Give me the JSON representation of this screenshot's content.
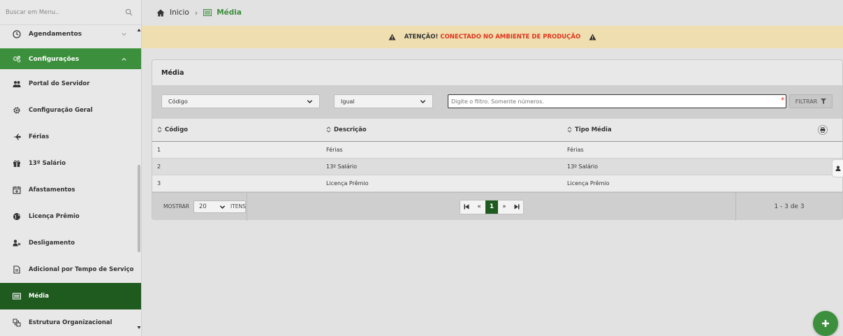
{
  "sidebar": {
    "search_placeholder": "Buscar em Menu..",
    "items": [
      {
        "label": "Agendamentos",
        "icon": "clock-icon"
      },
      {
        "label": "Configurações",
        "icon": "gears-icon"
      },
      {
        "label": "Portal do Servidor",
        "icon": "users-icon"
      },
      {
        "label": "Configuração Geral",
        "icon": "gear-icon"
      },
      {
        "label": "Férias",
        "icon": "plane-icon"
      },
      {
        "label": "13º Salário",
        "icon": "gift-icon"
      },
      {
        "label": "Afastamentos",
        "icon": "calendar-plus-icon"
      },
      {
        "label": "Licença Prêmio",
        "icon": "globe-icon"
      },
      {
        "label": "Desligamento",
        "icon": "user-times-icon"
      },
      {
        "label": "Adicional por Tempo de Serviço",
        "icon": "file-icon"
      },
      {
        "label": "Média",
        "icon": "list-icon"
      },
      {
        "label": "Estrutura Organizacional",
        "icon": "sitemap-icon"
      }
    ]
  },
  "breadcrumb": {
    "home": "Inicio",
    "current": "Média"
  },
  "alert": {
    "prefix": "ATENÇÃO!",
    "message": "CONECTADO NO AMBIENTE DE PRODUÇÃO"
  },
  "panel": {
    "title": "Média",
    "filter": {
      "field": "Código",
      "operator": "Igual",
      "placeholder": "Digite o filtro. Somente números.",
      "button": "FILTRAR"
    },
    "columns": [
      "Código",
      "Descrição",
      "Tipo Média"
    ],
    "rows": [
      [
        "1",
        "Férias",
        "Férias"
      ],
      [
        "2",
        "13º Salário",
        "13º Salário"
      ],
      [
        "3",
        "Licença Prêmio",
        "Licença Prêmio"
      ]
    ],
    "pager": {
      "show_label": "MOSTRAR",
      "page_size": "20",
      "items_label": "ITENS",
      "first": "⏮",
      "prev": "«",
      "current": "1",
      "next": "»",
      "last": "⏭",
      "summary": "1 - 3 de 3"
    }
  },
  "colors": {
    "green": "#3c8f3c",
    "dark_green": "#1f5a1f",
    "alert_bg": "#efdfb0",
    "alert_red": "#e0331c"
  }
}
